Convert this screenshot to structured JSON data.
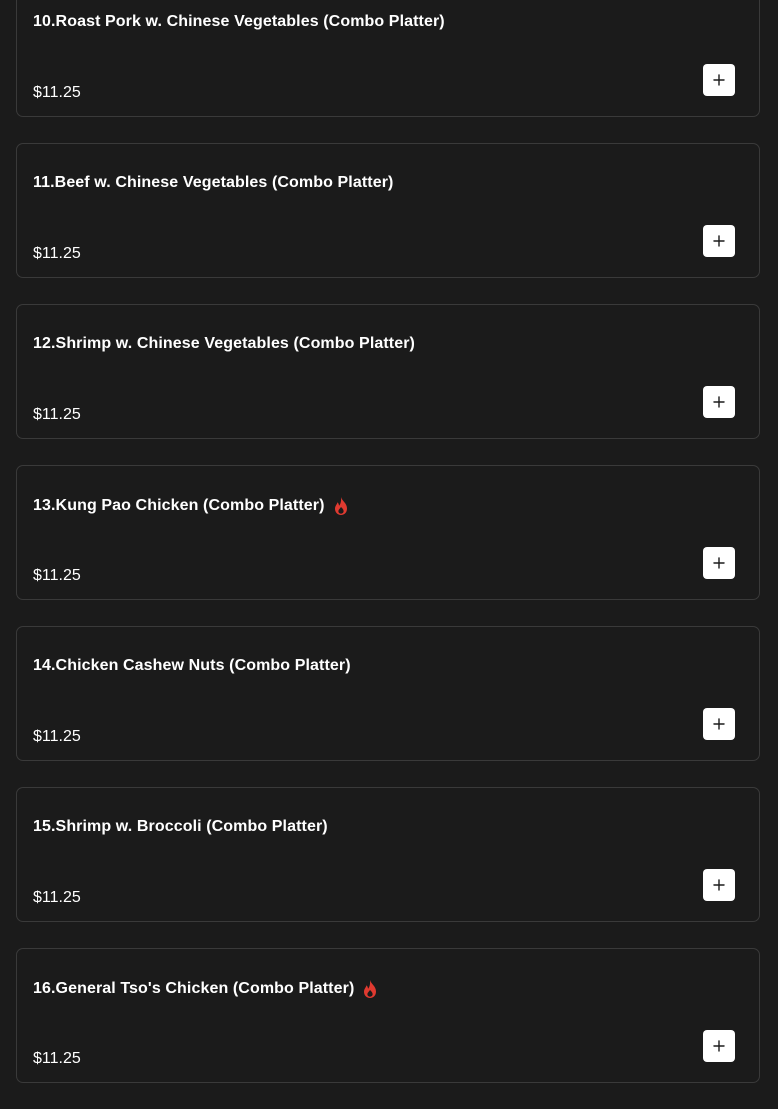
{
  "menu": {
    "accent_color": "#e03a30",
    "items": [
      {
        "name": "10.Roast Pork w. Chinese Vegetables (Combo Platter)",
        "price": "$11.25",
        "spicy": false
      },
      {
        "name": "11.Beef w. Chinese Vegetables (Combo Platter)",
        "price": "$11.25",
        "spicy": false
      },
      {
        "name": "12.Shrimp w. Chinese Vegetables (Combo Platter)",
        "price": "$11.25",
        "spicy": false
      },
      {
        "name": "13.Kung Pao Chicken (Combo Platter)",
        "price": "$11.25",
        "spicy": true
      },
      {
        "name": "14.Chicken Cashew Nuts (Combo Platter)",
        "price": "$11.25",
        "spicy": false
      },
      {
        "name": "15.Shrimp w. Broccoli (Combo Platter)",
        "price": "$11.25",
        "spicy": false
      },
      {
        "name": "16.General Tso's Chicken (Combo Platter)",
        "price": "$11.25",
        "spicy": true
      }
    ],
    "add_icon": "plus-icon",
    "spicy_icon": "flame-icon"
  }
}
